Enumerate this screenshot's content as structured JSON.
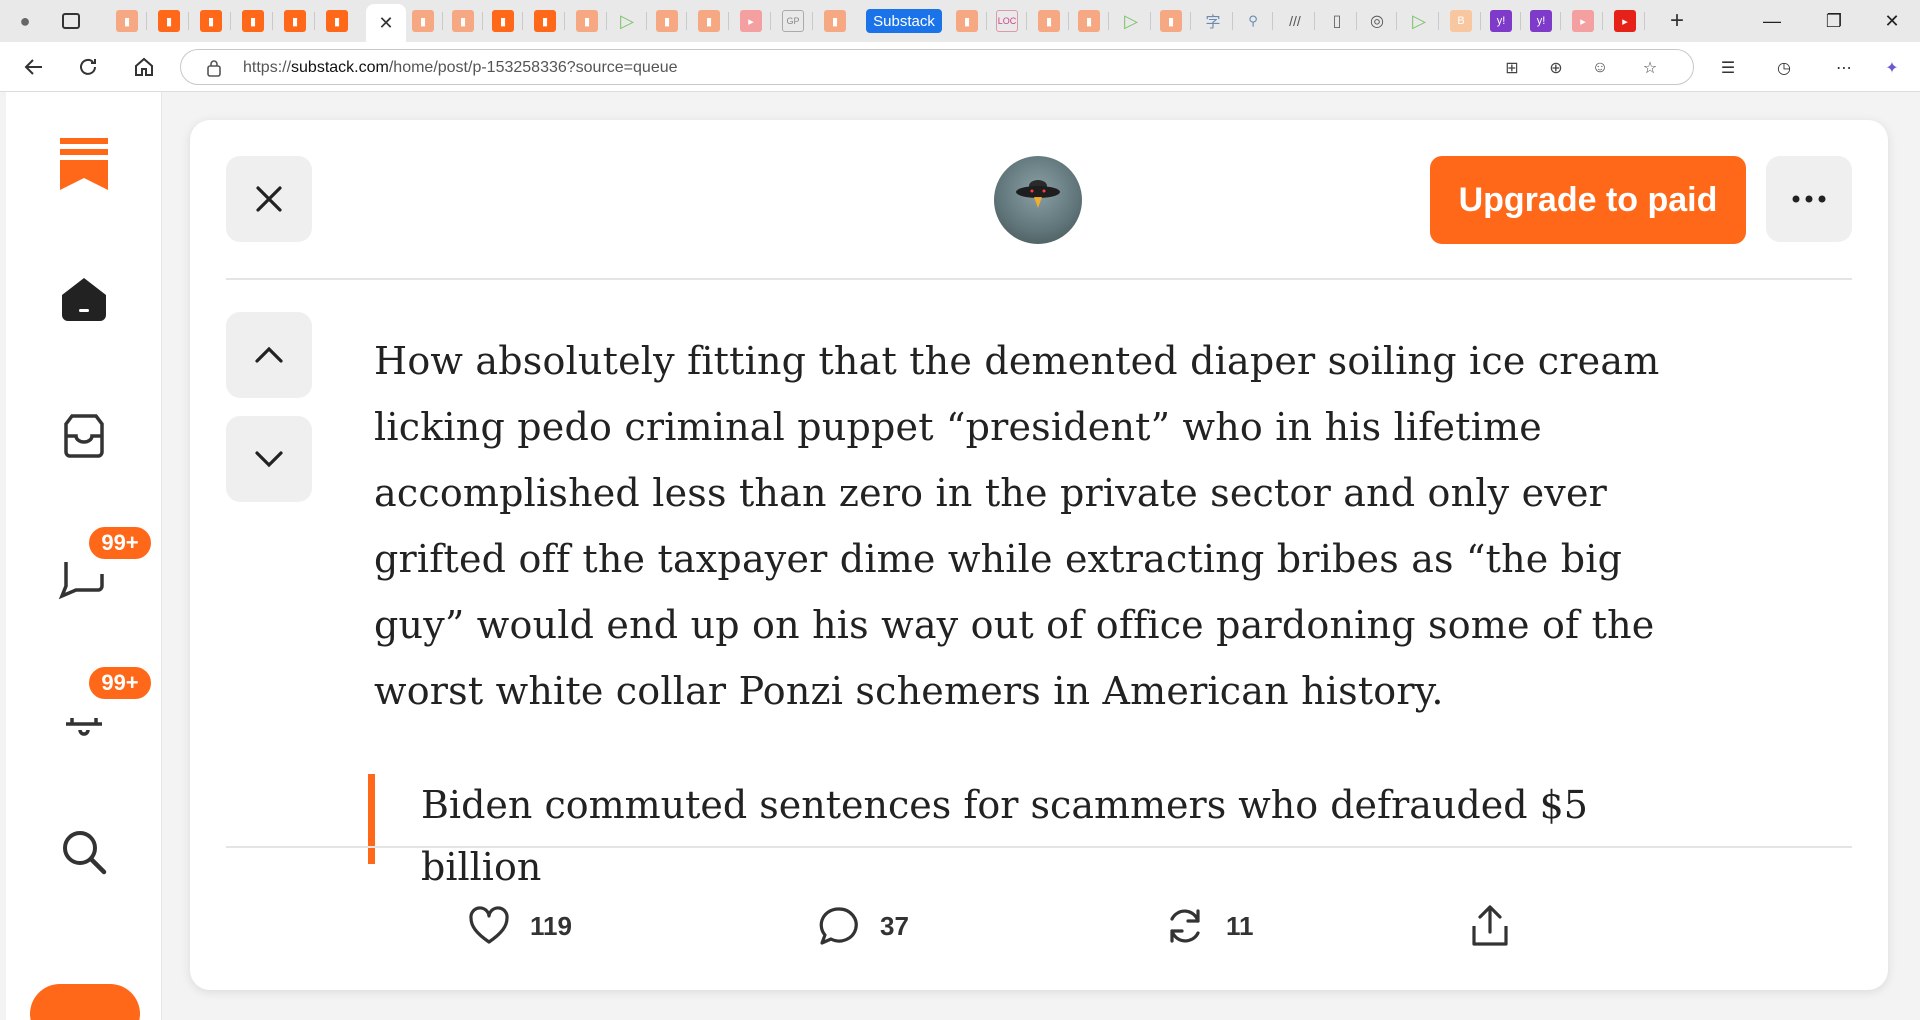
{
  "browser": {
    "titled_tab": "Substack",
    "url_prefix": "https://",
    "url_host": "substack.com",
    "url_path": "/home/post/p-153258336?source=queue"
  },
  "sidebar": {
    "items": [
      {
        "name": "home",
        "icon": "home-icon"
      },
      {
        "name": "inbox",
        "icon": "inbox-icon"
      },
      {
        "name": "chat",
        "icon": "chat-icon",
        "badge": "99+"
      },
      {
        "name": "activity",
        "icon": "bell-icon",
        "badge": "99+"
      },
      {
        "name": "search",
        "icon": "search-icon"
      }
    ]
  },
  "post": {
    "upgrade_label": "Upgrade to paid",
    "body": "How absolutely fitting that the demented diaper soiling ice cream licking pedo criminal puppet “president” who in his lifetime accomplished less than zero in the private sector and only ever grifted off the taxpayer dime while extracting bribes as “the big guy” would end up on his way out of office pardoning some of the worst white collar Ponzi schemers in American history.",
    "quote": "Biden commuted sentences for scammers who defrauded $5 billion"
  },
  "actions": {
    "likes": "119",
    "comments": "37",
    "restacks": "11"
  },
  "colors": {
    "accent": "#ff6719",
    "tab_highlight": "#1a73e8"
  }
}
